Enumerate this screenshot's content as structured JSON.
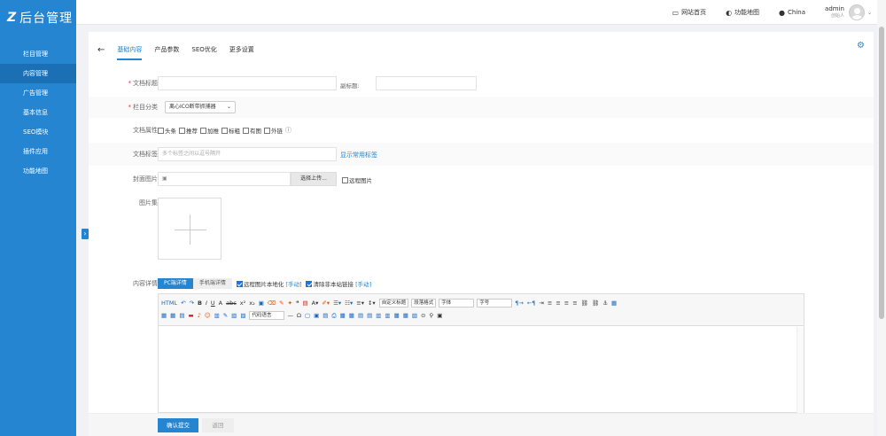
{
  "app": {
    "logo_mark": "Z",
    "logo_text": "后台管理"
  },
  "sidebar": {
    "items": [
      {
        "label": "栏目管理"
      },
      {
        "label": "内容管理"
      },
      {
        "label": "广告管理"
      },
      {
        "label": "基本信息"
      },
      {
        "label": "SEO模块"
      },
      {
        "label": "插件应用"
      },
      {
        "label": "功能地图"
      }
    ],
    "collapse_glyph": "›"
  },
  "topbar": {
    "home_label": "网站首页",
    "map_label": "功能地图",
    "lang_label": "China",
    "user_name": "admin",
    "user_role": "创始人"
  },
  "tabs": [
    {
      "label": "基础内容"
    },
    {
      "label": "产品参数"
    },
    {
      "label": "SEO优化"
    },
    {
      "label": "更多设置"
    }
  ],
  "form": {
    "title_label": "文档标题",
    "subtitle_label": "副标题:",
    "category_label": "栏目分类",
    "category_value": "离心ICO断带抓捕器",
    "attr_label": "文档属性",
    "attrs": [
      "头条",
      "推荐",
      "加推",
      "标粗",
      "有图",
      "外链"
    ],
    "tags_label": "文档标签",
    "tags_placeholder": "多个标签之间以逗号隔开",
    "tags_link": "显示常用标签",
    "cover_label": "封面图片",
    "upload_button": "选择上传...",
    "remote_image": "远程图片",
    "gallery_label": "图片集",
    "detail_label": "内容详情",
    "pc_tab": "PC端详情",
    "mobile_tab": "手机端详情",
    "localize_option": "远程图片本地化",
    "localize_manual": "[手动]",
    "clear_links_option": "清除非本站链接",
    "clear_links_manual": "[手动]"
  },
  "editor": {
    "custom_title": "自定义标题",
    "para_format": "段落格式",
    "font": "字体",
    "font_size": "字号",
    "code_lang": "代码语言"
  },
  "footer": {
    "submit": "确认提交",
    "back": "返回"
  }
}
